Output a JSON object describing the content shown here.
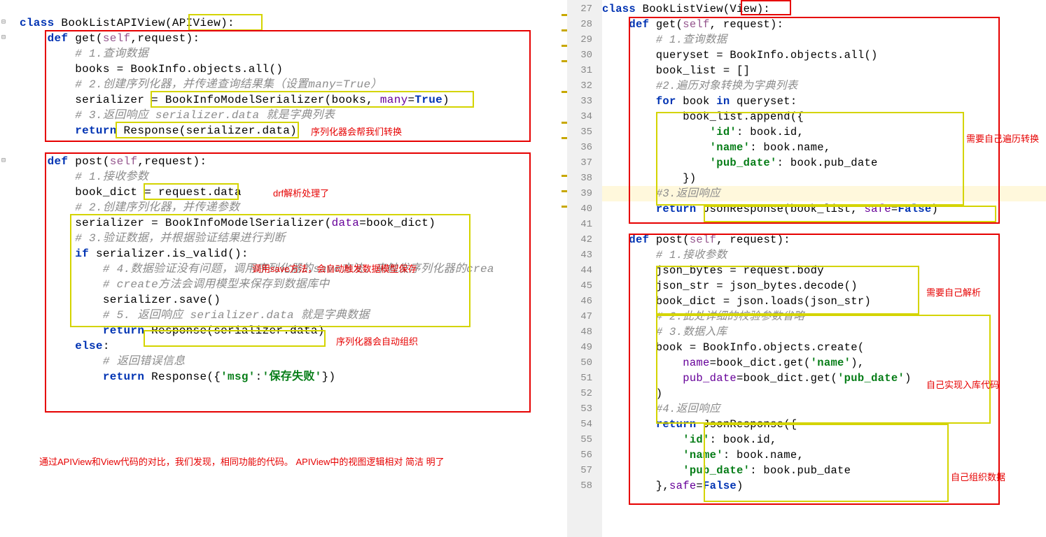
{
  "left": {
    "lines": [
      {
        "parts": [
          {
            "t": "class ",
            "c": "kw"
          },
          {
            "t": "BookListAPIView(APIView):",
            "c": ""
          }
        ]
      },
      {
        "parts": [
          {
            "t": "    ",
            "c": ""
          },
          {
            "t": "def ",
            "c": "kw"
          },
          {
            "t": "get(",
            "c": ""
          },
          {
            "t": "self",
            "c": "self"
          },
          {
            "t": ",request):",
            "c": ""
          }
        ]
      },
      {
        "parts": [
          {
            "t": "        ",
            "c": ""
          },
          {
            "t": "# 1.查询数据",
            "c": "cm"
          }
        ]
      },
      {
        "parts": [
          {
            "t": "        books = BookInfo.objects.all()",
            "c": ""
          }
        ]
      },
      {
        "parts": [
          {
            "t": "        ",
            "c": ""
          },
          {
            "t": "# 2.创建序列化器，并传递查询结果集（设置many=True）",
            "c": "cm"
          }
        ]
      },
      {
        "parts": [
          {
            "t": "        serializer = BookInfoModelSerializer(books, ",
            "c": ""
          },
          {
            "t": "many",
            "c": "param"
          },
          {
            "t": "=",
            "c": ""
          },
          {
            "t": "True",
            "c": "kw"
          },
          {
            "t": ")",
            "c": ""
          }
        ]
      },
      {
        "parts": [
          {
            "t": "        ",
            "c": ""
          },
          {
            "t": "# 3.返回响应 serializer.data 就是字典列表",
            "c": "cm"
          }
        ]
      },
      {
        "parts": [
          {
            "t": "        ",
            "c": ""
          },
          {
            "t": "return ",
            "c": "kw"
          },
          {
            "t": "Response(serializer.data)",
            "c": ""
          }
        ]
      },
      {
        "parts": [
          {
            "t": "",
            "c": ""
          }
        ]
      },
      {
        "parts": [
          {
            "t": "    ",
            "c": ""
          },
          {
            "t": "def ",
            "c": "kw"
          },
          {
            "t": "post(",
            "c": ""
          },
          {
            "t": "self",
            "c": "self"
          },
          {
            "t": ",request):",
            "c": ""
          }
        ]
      },
      {
        "parts": [
          {
            "t": "        ",
            "c": ""
          },
          {
            "t": "# ",
            "c": "cm"
          },
          {
            "t": "1.接收参数",
            "c": "cm"
          }
        ]
      },
      {
        "parts": [
          {
            "t": "        book_dict = request.data",
            "c": ""
          }
        ]
      },
      {
        "parts": [
          {
            "t": "        ",
            "c": ""
          },
          {
            "t": "# 2.创建序列化器，并传递参数",
            "c": "cm"
          }
        ]
      },
      {
        "parts": [
          {
            "t": "        serializer = BookInfoModelSerializer(",
            "c": ""
          },
          {
            "t": "data",
            "c": "param"
          },
          {
            "t": "=book_dict)",
            "c": ""
          }
        ]
      },
      {
        "parts": [
          {
            "t": "        ",
            "c": ""
          },
          {
            "t": "# 3.验证数据，并根据验证结果进行判断",
            "c": "cm"
          }
        ]
      },
      {
        "parts": [
          {
            "t": "        ",
            "c": ""
          },
          {
            "t": "if ",
            "c": "kw"
          },
          {
            "t": "serializer.is_valid():",
            "c": ""
          }
        ]
      },
      {
        "parts": [
          {
            "t": "            ",
            "c": ""
          },
          {
            "t": "# 4.数据验证没有问题，调用序列化器的save方法。来触发序列化器的crea",
            "c": "cm"
          }
        ]
      },
      {
        "parts": [
          {
            "t": "            ",
            "c": ""
          },
          {
            "t": "# create方法会调用模型来保存到数据库中",
            "c": "cm"
          }
        ]
      },
      {
        "parts": [
          {
            "t": "            serializer.save()",
            "c": ""
          }
        ]
      },
      {
        "parts": [
          {
            "t": "            ",
            "c": ""
          },
          {
            "t": "# 5. 返回响应 serializer.data 就是字典数据",
            "c": "cm"
          }
        ]
      },
      {
        "parts": [
          {
            "t": "            ",
            "c": ""
          },
          {
            "t": "return ",
            "c": "kw"
          },
          {
            "t": "Response(serializer.data)",
            "c": ""
          }
        ]
      },
      {
        "parts": [
          {
            "t": "        ",
            "c": ""
          },
          {
            "t": "else",
            "c": "kw"
          },
          {
            "t": ":",
            "c": ""
          }
        ]
      },
      {
        "parts": [
          {
            "t": "            ",
            "c": ""
          },
          {
            "t": "# 返回错误信息",
            "c": "cm"
          }
        ]
      },
      {
        "parts": [
          {
            "t": "            ",
            "c": ""
          },
          {
            "t": "return ",
            "c": "kw"
          },
          {
            "t": "Response({",
            "c": ""
          },
          {
            "t": "'msg'",
            "c": "str"
          },
          {
            "t": ":",
            "c": ""
          },
          {
            "t": "'保存失败'",
            "c": "str"
          },
          {
            "t": "})",
            "c": ""
          }
        ]
      }
    ],
    "annotations": {
      "label1": "序列化器会帮我们转换",
      "label2": "drf解析处理了",
      "label3": "调用save方法，会自动触发数据模型保存",
      "label4": "序列化器会自动组织",
      "label5": "通过APIView和View代码的对比，我们发现，相同功能的代码。 APIView中的视图逻辑相对 简洁 明了"
    }
  },
  "right": {
    "line_numbers": [
      "27",
      "28",
      "29",
      "30",
      "31",
      "32",
      "33",
      "34",
      "35",
      "36",
      "37",
      "38",
      "39",
      "40",
      "41",
      "42",
      "43",
      "44",
      "45",
      "46",
      "47",
      "48",
      "49",
      "50",
      "51",
      "52",
      "53",
      "54",
      "55",
      "56",
      "57",
      "58"
    ],
    "lines": [
      {
        "parts": [
          {
            "t": "class ",
            "c": "kw"
          },
          {
            "t": "BookListView(View):",
            "c": ""
          }
        ]
      },
      {
        "parts": [
          {
            "t": "    ",
            "c": ""
          },
          {
            "t": "def ",
            "c": "kw"
          },
          {
            "t": "get(",
            "c": ""
          },
          {
            "t": "self",
            "c": "self"
          },
          {
            "t": ", request):",
            "c": ""
          }
        ]
      },
      {
        "parts": [
          {
            "t": "        ",
            "c": ""
          },
          {
            "t": "# 1.查询数据",
            "c": "cm"
          }
        ]
      },
      {
        "parts": [
          {
            "t": "        queryset = BookInfo.objects.all()",
            "c": ""
          }
        ]
      },
      {
        "parts": [
          {
            "t": "        book_list = []",
            "c": ""
          }
        ]
      },
      {
        "parts": [
          {
            "t": "        ",
            "c": ""
          },
          {
            "t": "#2.遍历对象转换为字典列表",
            "c": "cm"
          }
        ]
      },
      {
        "parts": [
          {
            "t": "        ",
            "c": ""
          },
          {
            "t": "for ",
            "c": "kw"
          },
          {
            "t": "book ",
            "c": ""
          },
          {
            "t": "in ",
            "c": "kw"
          },
          {
            "t": "queryset:",
            "c": ""
          }
        ]
      },
      {
        "parts": [
          {
            "t": "            book_list.append({",
            "c": ""
          }
        ]
      },
      {
        "parts": [
          {
            "t": "                ",
            "c": ""
          },
          {
            "t": "'id'",
            "c": "str"
          },
          {
            "t": ": book.id,",
            "c": ""
          }
        ]
      },
      {
        "parts": [
          {
            "t": "                ",
            "c": ""
          },
          {
            "t": "'name'",
            "c": "str"
          },
          {
            "t": ": book.name,",
            "c": ""
          }
        ]
      },
      {
        "parts": [
          {
            "t": "                ",
            "c": ""
          },
          {
            "t": "'pub_date'",
            "c": "str"
          },
          {
            "t": ": book.pub_date",
            "c": ""
          }
        ]
      },
      {
        "parts": [
          {
            "t": "            })",
            "c": ""
          }
        ]
      },
      {
        "hl": true,
        "parts": [
          {
            "t": "        ",
            "c": ""
          },
          {
            "t": "#3.返回响应",
            "c": "cm"
          }
        ]
      },
      {
        "parts": [
          {
            "t": "        ",
            "c": ""
          },
          {
            "t": "return ",
            "c": "kw"
          },
          {
            "t": "JsonResponse(book_list, ",
            "c": ""
          },
          {
            "t": "safe",
            "c": "param"
          },
          {
            "t": "=",
            "c": ""
          },
          {
            "t": "False",
            "c": "kw"
          },
          {
            "t": ")",
            "c": ""
          }
        ]
      },
      {
        "parts": [
          {
            "t": "",
            "c": ""
          }
        ]
      },
      {
        "parts": [
          {
            "t": "    ",
            "c": ""
          },
          {
            "t": "def ",
            "c": "kw"
          },
          {
            "t": "post(",
            "c": ""
          },
          {
            "t": "self",
            "c": "self"
          },
          {
            "t": ", request):",
            "c": ""
          }
        ]
      },
      {
        "parts": [
          {
            "t": "        ",
            "c": ""
          },
          {
            "t": "# 1.接收参数",
            "c": "cm"
          }
        ]
      },
      {
        "parts": [
          {
            "t": "        json_bytes = request.body",
            "c": ""
          }
        ]
      },
      {
        "parts": [
          {
            "t": "        json_str = json_bytes.decode()",
            "c": ""
          }
        ]
      },
      {
        "parts": [
          {
            "t": "        book_dict = json.loads(json_str)",
            "c": ""
          }
        ]
      },
      {
        "parts": [
          {
            "t": "        ",
            "c": ""
          },
          {
            "t": "# 2.此处详细的校验参数省略",
            "c": "cm"
          }
        ]
      },
      {
        "parts": [
          {
            "t": "        ",
            "c": ""
          },
          {
            "t": "# 3.数据入库",
            "c": "cm"
          }
        ]
      },
      {
        "parts": [
          {
            "t": "        book = BookInfo.objects.create(",
            "c": ""
          }
        ]
      },
      {
        "parts": [
          {
            "t": "            ",
            "c": ""
          },
          {
            "t": "name",
            "c": "param"
          },
          {
            "t": "=book_dict.get(",
            "c": ""
          },
          {
            "t": "'name'",
            "c": "str"
          },
          {
            "t": "),",
            "c": ""
          }
        ]
      },
      {
        "parts": [
          {
            "t": "            ",
            "c": ""
          },
          {
            "t": "pub_date",
            "c": "param"
          },
          {
            "t": "=book_dict.get(",
            "c": ""
          },
          {
            "t": "'pub_date'",
            "c": "str"
          },
          {
            "t": ")",
            "c": ""
          }
        ]
      },
      {
        "parts": [
          {
            "t": "        )",
            "c": ""
          }
        ]
      },
      {
        "parts": [
          {
            "t": "        ",
            "c": ""
          },
          {
            "t": "#4.返回响应",
            "c": "cm"
          }
        ]
      },
      {
        "parts": [
          {
            "t": "        ",
            "c": ""
          },
          {
            "t": "return ",
            "c": "kw"
          },
          {
            "t": "JsonResponse({",
            "c": ""
          }
        ]
      },
      {
        "parts": [
          {
            "t": "            ",
            "c": ""
          },
          {
            "t": "'id'",
            "c": "str"
          },
          {
            "t": ": book.id,",
            "c": ""
          }
        ]
      },
      {
        "parts": [
          {
            "t": "            ",
            "c": ""
          },
          {
            "t": "'name'",
            "c": "str"
          },
          {
            "t": ": book.name,",
            "c": ""
          }
        ]
      },
      {
        "parts": [
          {
            "t": "            ",
            "c": ""
          },
          {
            "t": "'pub_date'",
            "c": "str"
          },
          {
            "t": ": book.pub_date",
            "c": ""
          }
        ]
      },
      {
        "parts": [
          {
            "t": "        },",
            "c": ""
          },
          {
            "t": "safe",
            "c": "param"
          },
          {
            "t": "=",
            "c": ""
          },
          {
            "t": "False",
            "c": "kw"
          },
          {
            "t": ")",
            "c": ""
          }
        ]
      }
    ],
    "annotations": {
      "label1": "需要自己遍历转换",
      "label2": "需要自己解析",
      "label3": "自己实现入库代码",
      "label4": "自己组织数据"
    }
  }
}
